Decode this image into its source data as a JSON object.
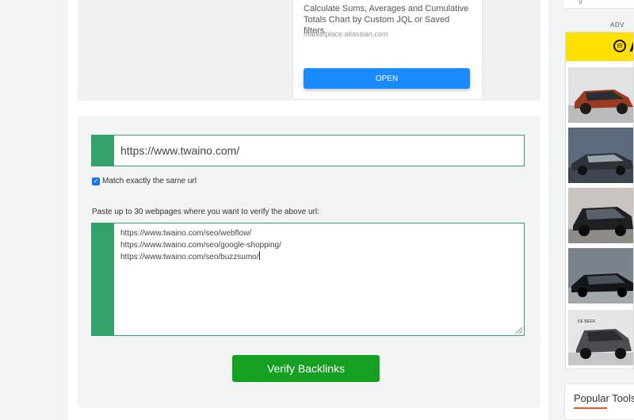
{
  "ad": {
    "description": "Calculate Sums, Averages and Cumulative Totals Chart by Custom JQL or Saved filters",
    "domain": "marketplace.atlassian.com",
    "open_label": "OPEN"
  },
  "form": {
    "url_value": "https://www.twaino.com/",
    "match_label": "Match exactly the same url",
    "match_checked": true,
    "paste_label": "Paste up to 30 webpages where you want to verify the above url:",
    "pages": [
      "https://www.twaino.com/seo/webflow/",
      "https://www.twaino.com/seo/google-shopping/",
      "https://www.twaino.com/seo/buzzsumo/"
    ],
    "verify_label": "Verify Backlinks",
    "accent_color": "#34a16b",
    "button_color": "#16a021"
  },
  "sidebar": {
    "top_text": "g",
    "adv_label": "ADV",
    "ad_header_letter": "A",
    "ad_footer_label": "DE BEER",
    "popular_title": "Popular Tools"
  }
}
